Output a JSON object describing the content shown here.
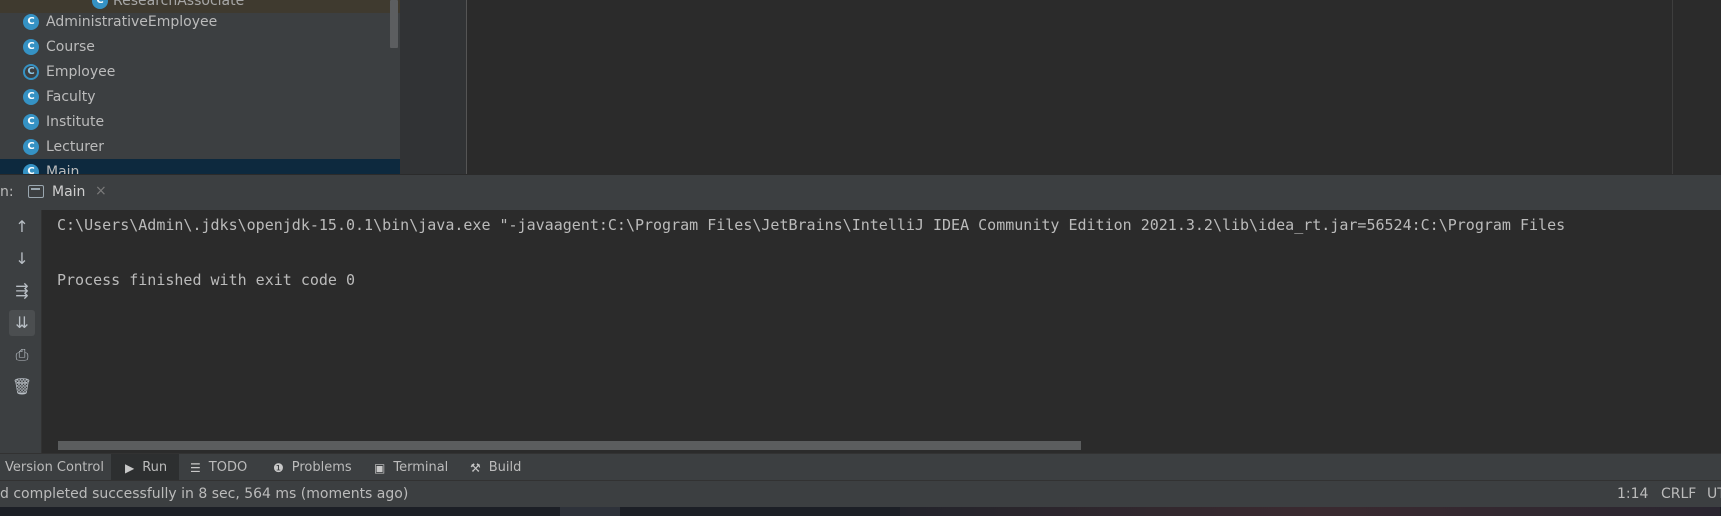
{
  "project_tree": {
    "items": [
      {
        "label": "ResearchAssociate",
        "icon": "class-icon"
      },
      {
        "label": "AdministrativeEmployee",
        "icon": "class-icon"
      },
      {
        "label": "Course",
        "icon": "class-icon"
      },
      {
        "label": "Employee",
        "icon": "abstract-class-icon"
      },
      {
        "label": "Faculty",
        "icon": "class-icon"
      },
      {
        "label": "Institute",
        "icon": "class-icon"
      },
      {
        "label": "Lecturer",
        "icon": "class-icon"
      },
      {
        "label": "Main",
        "icon": "runnable-class-icon"
      }
    ],
    "icon_letter": "C"
  },
  "run_window": {
    "prefix": "n:",
    "tab_label": "Main",
    "tab_close": "×",
    "console_lines": [
      "C:\\Users\\Admin\\.jdks\\openjdk-15.0.1\\bin\\java.exe \"-javaagent:C:\\Program Files\\JetBrains\\IntelliJ IDEA Community Edition 2021.3.2\\lib\\idea_rt.jar=56524:C:\\Program Files",
      "",
      "Process finished with exit code 0"
    ],
    "toolbar": [
      {
        "name": "up-arrow-icon",
        "glyph": "↑"
      },
      {
        "name": "down-arrow-icon",
        "glyph": "↓"
      },
      {
        "name": "soft-wrap-icon",
        "glyph": "⇶"
      },
      {
        "name": "scroll-to-end-icon",
        "glyph": "⇊"
      },
      {
        "name": "print-icon",
        "glyph": "⎙"
      },
      {
        "name": "trash-icon",
        "glyph": "🗑"
      }
    ]
  },
  "tool_strip": {
    "items": [
      {
        "label": "Version Control",
        "icon": ""
      },
      {
        "label": "Run",
        "icon": "▶"
      },
      {
        "label": "TODO",
        "icon": "☰"
      },
      {
        "label": "Problems",
        "icon": "❶"
      },
      {
        "label": "Terminal",
        "icon": "▣"
      },
      {
        "label": "Build",
        "icon": "⚒"
      }
    ]
  },
  "status_bar": {
    "message": "d completed successfully in 8 sec, 564 ms (moments ago)",
    "position": "1:14",
    "line_separator": "CRLF",
    "encoding": "UT"
  },
  "colors": {
    "background": "#2b2b2b",
    "panel": "#3c3f41",
    "selection": "#0d293e",
    "class_icon": "#3592c4"
  }
}
